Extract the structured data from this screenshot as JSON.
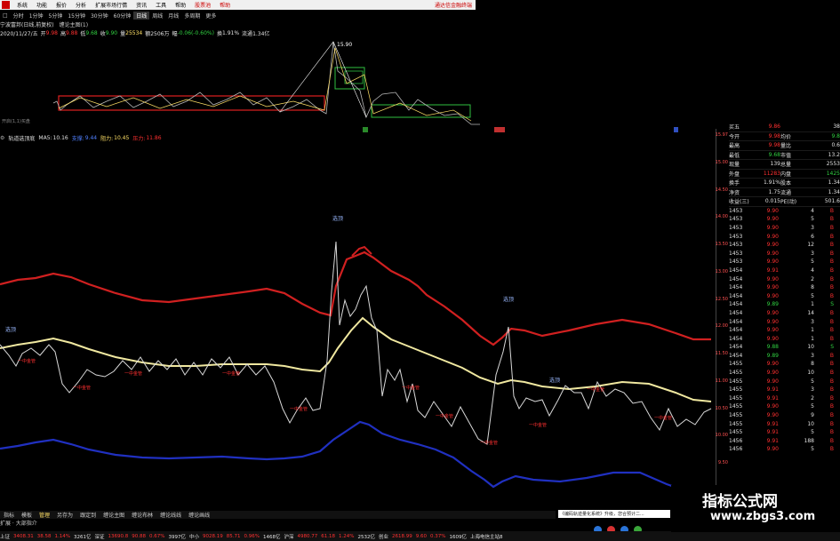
{
  "menu": {
    "items": [
      "系统",
      "功能",
      "报价",
      "分析",
      "扩展市场行情",
      "资讯",
      "工具",
      "帮助",
      "股票池",
      "帮助"
    ],
    "brand": "通达信金融终端"
  },
  "periods": {
    "items": [
      "分时",
      "1分钟",
      "5分钟",
      "15分钟",
      "30分钟",
      "60分钟",
      "日线",
      "周线",
      "月线",
      "多周期",
      "更多"
    ],
    "active": "日线"
  },
  "title": {
    "stock": "宁波富邦(日线,前复权)",
    "chart": "缠论主图(1)"
  },
  "info": {
    "date": "2020/11/27/五",
    "open_label": "开",
    "open": "9.98",
    "high_label": "高",
    "high": "9.88",
    "low_label": "低",
    "low": "9.68",
    "close_label": "收",
    "close": "9.90",
    "vol_label": "量",
    "vol": "25534",
    "amt_label": "额",
    "amt": "2506万",
    "chg_label": "幅",
    "chg": "-0.06(-0.60%)",
    "turn_label": "换",
    "turn": "1.91%",
    "float_label": "流通",
    "float": "1.34亿"
  },
  "top_chart": {
    "peak_label": "15.90",
    "sub_label": "开启(1,1)买盘"
  },
  "indicator_bar": {
    "name": "轨道选顶底",
    "ma5_label": "MA5:",
    "ma5": "10.16",
    "line1_label": "支撑:",
    "line1": "9.44",
    "line2_label": "阻力:",
    "line2": "10.45",
    "line3_label": "压力:",
    "line3": "11.86"
  },
  "main_chart": {
    "top_markers": [
      "选顶",
      "选顶",
      "选顶",
      "选顶"
    ],
    "buy_label": "一中金管"
  },
  "scale": {
    "ticks": [
      "15.97",
      "15.00",
      "14.50",
      "14.00",
      "13.50",
      "13.00",
      "12.50",
      "12.00",
      "11.50",
      "11.00",
      "10.50",
      "10.00",
      "9.50",
      "9.00"
    ]
  },
  "quote": {
    "rows": [
      {
        "l": "买五",
        "v1": "9.86",
        "l2": "",
        "v2": "38",
        "c1": "#ff3030",
        "c2": "#e0e0e0"
      },
      {
        "l": "今开",
        "v1": "9.98",
        "l2": "均价",
        "v2": "9.8",
        "c1": "#ff3030",
        "c2": "#30d040"
      },
      {
        "l": "最高",
        "v1": "9.98",
        "l2": "量比",
        "v2": "0.6",
        "c1": "#ff3030",
        "c2": "#e0e0e0"
      },
      {
        "l": "最低",
        "v1": "9.68",
        "l2": "市值",
        "v2": "13.2",
        "c1": "#30d040",
        "c2": "#e0e0e0"
      },
      {
        "l": "现量",
        "v1": "139",
        "l2": "总量",
        "v2": "2553",
        "c1": "#e0e0e0",
        "c2": "#e0e0e0"
      },
      {
        "l": "外盘",
        "v1": "11283",
        "l2": "内盘",
        "v2": "1425",
        "c1": "#ff3030",
        "c2": "#30d040"
      },
      {
        "l": "换手",
        "v1": "1.91%",
        "l2": "股本",
        "v2": "1.34",
        "c1": "#e0e0e0",
        "c2": "#e0e0e0"
      },
      {
        "l": "净资",
        "v1": "1.75",
        "l2": "流通",
        "v2": "1.34",
        "c1": "#e0e0e0",
        "c2": "#e0e0e0"
      },
      {
        "l": "收益(三)",
        "v1": "0.015",
        "l2": "PE(动)",
        "v2": "501.6",
        "c1": "#e0e0e0",
        "c2": "#e0e0e0"
      }
    ],
    "trades": [
      {
        "t": "1453",
        "p": "9.90",
        "v": "4",
        "s": "B"
      },
      {
        "t": "1453",
        "p": "9.90",
        "v": "5",
        "s": "B"
      },
      {
        "t": "1453",
        "p": "9.90",
        "v": "3",
        "s": "B"
      },
      {
        "t": "1453",
        "p": "9.90",
        "v": "6",
        "s": "B"
      },
      {
        "t": "1453",
        "p": "9.90",
        "v": "12",
        "s": "B"
      },
      {
        "t": "1453",
        "p": "9.90",
        "v": "3",
        "s": "B"
      },
      {
        "t": "1453",
        "p": "9.90",
        "v": "5",
        "s": "B"
      },
      {
        "t": "1454",
        "p": "9.91",
        "v": "4",
        "s": "B"
      },
      {
        "t": "1454",
        "p": "9.90",
        "v": "2",
        "s": "B"
      },
      {
        "t": "1454",
        "p": "9.90",
        "v": "8",
        "s": "B"
      },
      {
        "t": "1454",
        "p": "9.90",
        "v": "5",
        "s": "B"
      },
      {
        "t": "1454",
        "p": "9.89",
        "v": "1",
        "s": "S"
      },
      {
        "t": "1454",
        "p": "9.90",
        "v": "14",
        "s": "B"
      },
      {
        "t": "1454",
        "p": "9.90",
        "v": "3",
        "s": "B"
      },
      {
        "t": "1454",
        "p": "9.90",
        "v": "1",
        "s": "B"
      },
      {
        "t": "1454",
        "p": "9.90",
        "v": "1",
        "s": "B"
      },
      {
        "t": "1454",
        "p": "9.88",
        "v": "10",
        "s": "S"
      },
      {
        "t": "1454",
        "p": "9.89",
        "v": "3",
        "s": "B"
      },
      {
        "t": "1455",
        "p": "9.90",
        "v": "8",
        "s": "B"
      },
      {
        "t": "1455",
        "p": "9.90",
        "v": "10",
        "s": "B"
      },
      {
        "t": "1455",
        "p": "9.90",
        "v": "5",
        "s": "B"
      },
      {
        "t": "1455",
        "p": "9.91",
        "v": "3",
        "s": "B"
      },
      {
        "t": "1455",
        "p": "9.91",
        "v": "2",
        "s": "B"
      },
      {
        "t": "1455",
        "p": "9.90",
        "v": "5",
        "s": "B"
      },
      {
        "t": "1455",
        "p": "9.90",
        "v": "9",
        "s": "B"
      },
      {
        "t": "1455",
        "p": "9.91",
        "v": "10",
        "s": "B"
      },
      {
        "t": "1455",
        "p": "9.91",
        "v": "5",
        "s": "B"
      },
      {
        "t": "1456",
        "p": "9.91",
        "v": "188",
        "s": "B"
      },
      {
        "t": "1456",
        "p": "9.90",
        "v": "5",
        "s": "B"
      }
    ]
  },
  "bottom_tabs": {
    "items": [
      "指标",
      "模板",
      "管理",
      "另存为",
      "跟定到",
      "缠论主图",
      "缠论布林",
      "缠论线线",
      "缠论画线"
    ],
    "active": "管理"
  },
  "page_indicator": "扩展 · 大部指介",
  "notice": "《编码轨迹量化系统》升级，您合预计二...",
  "ticker": [
    {
      "t": "上证",
      "c": "#e0e0e0"
    },
    {
      "t": "3408.31",
      "c": "#ff3030"
    },
    {
      "t": "38.58",
      "c": "#ff3030"
    },
    {
      "t": "1.14%",
      "c": "#ff3030"
    },
    {
      "t": "3261亿",
      "c": "#e0e0e0"
    },
    {
      "t": "深证",
      "c": "#e0e0e0"
    },
    {
      "t": "13690.8",
      "c": "#ff3030"
    },
    {
      "t": "90.88",
      "c": "#ff3030"
    },
    {
      "t": "0.67%",
      "c": "#ff3030"
    },
    {
      "t": "3997亿",
      "c": "#e0e0e0"
    },
    {
      "t": "中小",
      "c": "#e0e0e0"
    },
    {
      "t": "9028.19",
      "c": "#ff3030"
    },
    {
      "t": "85.71",
      "c": "#ff3030"
    },
    {
      "t": "0.96%",
      "c": "#ff3030"
    },
    {
      "t": "1468亿",
      "c": "#e0e0e0"
    },
    {
      "t": "沪深",
      "c": "#e0e0e0"
    },
    {
      "t": "4980.77",
      "c": "#ff3030"
    },
    {
      "t": "61.18",
      "c": "#ff3030"
    },
    {
      "t": "1.24%",
      "c": "#ff3030"
    },
    {
      "t": "2532亿",
      "c": "#e0e0e0"
    },
    {
      "t": "创业",
      "c": "#e0e0e0"
    },
    {
      "t": "2618.99",
      "c": "#ff3030"
    },
    {
      "t": "9.60",
      "c": "#ff3030"
    },
    {
      "t": "0.37%",
      "c": "#ff3030"
    },
    {
      "t": "1609亿",
      "c": "#e0e0e0"
    },
    {
      "t": "上海电信主站8",
      "c": "#e0e0e0"
    }
  ],
  "watermark": {
    "line1": "指标公式网",
    "line2": "www.zbgs3.com"
  },
  "colors": {
    "upper": "#d02020",
    "mid": "#f0e8a0",
    "lower": "#2030c0",
    "price": "#d8d8d8",
    "box_red": "#e02020",
    "box_green": "#30c040"
  }
}
